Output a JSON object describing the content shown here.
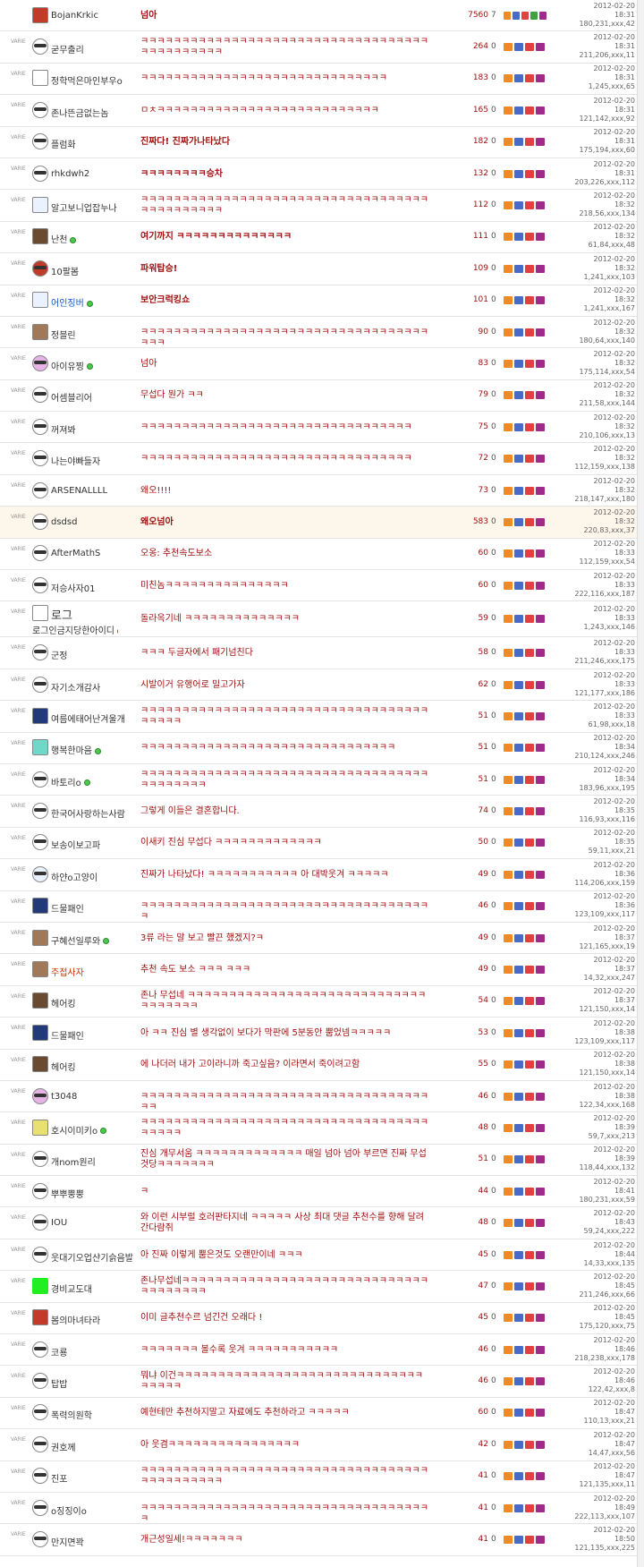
{
  "badge_label": "VARIE",
  "rows": [
    {
      "nick": "BojanKrkic",
      "title": "넘아",
      "views": "7560",
      "rec": "7",
      "date": "2012-02-20",
      "time": "18:31",
      "ip": "180,231,xxx,42",
      "av": "av-red sq",
      "bold": true,
      "top": true
    },
    {
      "nick": "굳무출리",
      "title": "ㅋㅋㅋㅋㅋㅋㅋㅋㅋㅋㅋㅋㅋㅋㅋㅋㅋㅋㅋㅋㅋㅋㅋㅋㅋㅋㅋㅋㅋㅋㅋㅋㅋㅋㅋㅋㅋㅋㅋㅋㅋㅋㅋㅋㅋ",
      "views": "264",
      "rec": "0",
      "date": "2012-02-20",
      "time": "18:31",
      "ip": "211,206,xxx,11",
      "av": ""
    },
    {
      "nick": "정학먹은마인부우o",
      "title": "ㅋㅋㅋㅋㅋㅋㅋㅋㅋㅋㅋㅋㅋㅋㅋㅋㅋㅋㅋㅋㅋㅋㅋㅋㅋㅋㅋㅋㅋㅋ",
      "views": "183",
      "rec": "0",
      "date": "2012-02-20",
      "time": "18:31",
      "ip": "1,245,xxx,65",
      "av": "sq"
    },
    {
      "nick": "존나뜬금없는놈",
      "title": "ㅁㅊㅋㅋㅋㅋㅋㅋㅋㅋㅋㅋㅋㅋㅋㅋㅋㅋㅋㅋㅋㅋㅋㅋㅋㅋㅋㅋㅋ",
      "views": "165",
      "rec": "0",
      "date": "2012-02-20",
      "time": "18:31",
      "ip": "121,142,xxx,92",
      "av": ""
    },
    {
      "nick": "플럼화",
      "title": "진짜다! 진짜가나타났다",
      "views": "182",
      "rec": "0",
      "date": "2012-02-20",
      "time": "18:31",
      "ip": "175,194,xxx,60",
      "av": "",
      "bold": true
    },
    {
      "nick": "rhkdwh2",
      "title": "ㅋㅋㅋㅋㅋㅋㅋㅋ승차",
      "views": "132",
      "rec": "0",
      "date": "2012-02-20",
      "time": "18:31",
      "ip": "203,226,xxx,112",
      "av": "",
      "bold": true
    },
    {
      "nick": "알고보니업잡누나",
      "title": "ㅋㅋㅋㅋㅋㅋㅋㅋㅋㅋㅋㅋㅋㅋㅋㅋㅋㅋㅋㅋㅋㅋㅋㅋㅋㅋㅋㅋㅋㅋㅋㅋㅋㅋㅋㅋㅋㅋㅋㅋㅋㅋㅋㅋㅋ",
      "views": "112",
      "rec": "0",
      "date": "2012-02-20",
      "time": "18:32",
      "ip": "218,56,xxx,134",
      "av": "av-blue sq"
    },
    {
      "nick": "난천",
      "title": "여기까지 ㅋㅋㅋㅋㅋㅋㅋㅋㅋㅋㅋㅋㅋㅋ",
      "views": "111",
      "rec": "0",
      "date": "2012-02-20",
      "time": "18:32",
      "ip": "61,84,xxx,48",
      "av": "av-dark sq",
      "on": true,
      "bold": true
    },
    {
      "nick": "10팔봄",
      "title": "파워탑승!",
      "views": "109",
      "rec": "0",
      "date": "2012-02-20",
      "time": "18:32",
      "ip": "1,241,xxx,103",
      "av": "av-red",
      "bold": true
    },
    {
      "nick": "어인징버",
      "title": "보안크럭킹쇼",
      "views": "101",
      "rec": "0",
      "date": "2012-02-20",
      "time": "18:32",
      "ip": "1,241,xxx,167",
      "av": "av-blue sq",
      "nc": "blue",
      "on": true,
      "bold": true
    },
    {
      "nick": "정블린",
      "title": "ㅋㅋㅋㅋㅋㅋㅋㅋㅋㅋㅋㅋㅋㅋㅋㅋㅋㅋㅋㅋㅋㅋㅋㅋㅋㅋㅋㅋㅋㅋㅋㅋㅋㅋㅋㅋㅋㅋ",
      "views": "90",
      "rec": "0",
      "date": "2012-02-20",
      "time": "18:32",
      "ip": "180,64,xxx,140",
      "av": "av-photo sq"
    },
    {
      "nick": "아이유찡",
      "title": "넘아",
      "views": "83",
      "rec": "0",
      "date": "2012-02-20",
      "time": "18:32",
      "ip": "175,114,xxx,54",
      "av": "av-pink",
      "on": true
    },
    {
      "nick": "어셈블리어",
      "title": "무섭다 뭔가 ㅋㅋ",
      "views": "79",
      "rec": "0",
      "date": "2012-02-20",
      "time": "18:32",
      "ip": "211,58,xxx,144",
      "av": ""
    },
    {
      "nick": "꺼져봐",
      "title": "ㅋㅋㅋㅋㅋㅋㅋㅋㅋㅋㅋㅋㅋㅋㅋㅋㅋㅋㅋㅋㅋㅋㅋㅋㅋㅋㅋㅋㅋㅋㅋㅋㅋ",
      "views": "75",
      "rec": "0",
      "date": "2012-02-20",
      "time": "18:32",
      "ip": "210,106,xxx,13",
      "av": ""
    },
    {
      "nick": "나는야빠들자",
      "title": "ㅋㅋㅋㅋㅋㅋㅋㅋㅋㅋㅋㅋㅋㅋㅋㅋㅋㅋㅋㅋㅋㅋㅋㅋㅋㅋㅋㅋㅋㅋㅋㅋㅋ",
      "views": "72",
      "rec": "0",
      "date": "2012-02-20",
      "time": "18:32",
      "ip": "112,159,xxx,138",
      "av": ""
    },
    {
      "nick": "ARSENALLLL",
      "title": "왜오!!!!",
      "views": "73",
      "rec": "0",
      "date": "2012-02-20",
      "time": "18:32",
      "ip": "218,147,xxx,180",
      "av": ""
    },
    {
      "nick": "dsdsd",
      "title": "왜오넘아",
      "views": "583",
      "rec": "0",
      "date": "2012-02-20",
      "time": "18:32",
      "ip": "220,83,xxx,37",
      "av": "",
      "bold": true,
      "hl": true
    },
    {
      "nick": "AfterMathS",
      "title": "오옹: 추천속도보소",
      "views": "60",
      "rec": "0",
      "date": "2012-02-20",
      "time": "18:33",
      "ip": "112,159,xxx,54",
      "av": ""
    },
    {
      "nick": "저승사자01",
      "title": "미친놈ㅋㅋㅋㅋㅋㅋㅋㅋㅋㅋㅋㅋㅋㅋㅋ",
      "views": "60",
      "rec": "0",
      "date": "2012-02-20",
      "time": "18:33",
      "ip": "222,116,xxx,187",
      "av": ""
    },
    {
      "nick": "로그인금지당한아이디",
      "title": "돌라옥기네 ㅋㅋㅋㅋㅋㅋㅋㅋㅋㅋㅋㅋㅋㅋ",
      "views": "59",
      "rec": "0",
      "date": "2012-02-20",
      "time": "18:33",
      "ip": "1,243,xxx,146",
      "av": "sq",
      "on": true,
      "tall": true,
      "extra": "로그"
    },
    {
      "nick": "군정",
      "title": "ㅋㅋㅋ 두글자에서 패기넘친다",
      "views": "58",
      "rec": "0",
      "date": "2012-02-20",
      "time": "18:33",
      "ip": "211,246,xxx,175",
      "av": ""
    },
    {
      "nick": "자기소개감사",
      "title": "시발이거 유행어로 밀고가자",
      "views": "62",
      "rec": "0",
      "date": "2012-02-20",
      "time": "18:33",
      "ip": "121,177,xxx,186",
      "av": ""
    },
    {
      "nick": "여름에태어난겨울개",
      "title": "ㅋㅋㅋㅋㅋㅋㅋㅋㅋㅋㅋㅋㅋㅋㅋㅋㅋㅋㅋㅋㅋㅋㅋㅋㅋㅋㅋㅋㅋㅋㅋㅋㅋㅋㅋㅋㅋㅋㅋㅋ",
      "views": "51",
      "rec": "0",
      "date": "2012-02-20",
      "time": "18:33",
      "ip": "61,98,xxx,18",
      "av": "av-navy sq"
    },
    {
      "nick": "행복한마음",
      "title": "ㅋㅋㅋㅋㅋㅋㅋㅋㅋㅋㅋㅋㅋㅋㅋㅋㅋㅋㅋㅋㅋㅋㅋㅋㅋㅋㅋㅋㅋㅋㅋ",
      "views": "51",
      "rec": "0",
      "date": "2012-02-20",
      "time": "18:34",
      "ip": "210,124,xxx,246",
      "av": "av-mint sq",
      "on": true
    },
    {
      "nick": "바토리o",
      "title": "ㅋㅋㅋㅋㅋㅋㅋㅋㅋㅋㅋㅋㅋㅋㅋㅋㅋㅋㅋㅋㅋㅋㅋㅋㅋㅋㅋㅋㅋㅋㅋㅋㅋㅋㅋㅋㅋㅋㅋㅋㅋㅋㅋ",
      "views": "51",
      "rec": "0",
      "date": "2012-02-20",
      "time": "18:34",
      "ip": "183,96,xxx,195",
      "av": "",
      "on": true
    },
    {
      "nick": "한국어사랑하는사람",
      "title": "그렇게 이들은 결혼합니다.",
      "views": "74",
      "rec": "0",
      "date": "2012-02-20",
      "time": "18:35",
      "ip": "116,93,xxx,116",
      "av": ""
    },
    {
      "nick": "보송이보고파",
      "title": "이새키 진심 무섭다 ㅋㅋㅋㅋㅋㅋㅋㅋㅋㅋㅋㅋㅋ",
      "views": "50",
      "rec": "0",
      "date": "2012-02-20",
      "time": "18:35",
      "ip": "59,11,xxx,21",
      "av": ""
    },
    {
      "nick": "하얀o고양이",
      "title": "진짜가 나타났다! ㅋㅋㅋㅋㅋㅋㅋㅋㅋㅋㅋ 아 대박웃겨 ㅋㅋㅋㅋㅋ",
      "views": "49",
      "rec": "0",
      "date": "2012-02-20",
      "time": "18:36",
      "ip": "114,206,xxx,159",
      "av": "av-blue"
    },
    {
      "nick": "드물패인",
      "title": "ㅋㅋㅋㅋㅋㅋㅋㅋㅋㅋㅋㅋㅋㅋㅋㅋㅋㅋㅋㅋㅋㅋㅋㅋㅋㅋㅋㅋㅋㅋㅋㅋㅋㅋㅋㅋ",
      "views": "46",
      "rec": "0",
      "date": "2012-02-20",
      "time": "18:36",
      "ip": "123,109,xxx,117",
      "av": "av-navy sq"
    },
    {
      "nick": "구혜선일루와",
      "title": "3류 라는 말 보고 빨끈 했겠지?ㅋ",
      "views": "49",
      "rec": "0",
      "date": "2012-02-20",
      "time": "18:37",
      "ip": "121,165,xxx,19",
      "av": "av-photo sq",
      "on": true
    },
    {
      "nick": "주접사자",
      "title": "추천 속도 보소 ㅋㅋㅋ ㅋㅋㅋ",
      "views": "49",
      "rec": "0",
      "date": "2012-02-20",
      "time": "18:37",
      "ip": "14,32,xxx,247",
      "av": "av-photo sq",
      "nc": "red"
    },
    {
      "nick": "헤어킹",
      "title": "존나 무섭네 ㅋㅋㅋㅋㅋㅋㅋㅋㅋㅋㅋㅋㅋㅋㅋㅋㅋㅋㅋㅋㅋㅋㅋㅋㅋㅋㅋㅋㅋㅋㅋㅋㅋㅋㅋㅋ",
      "views": "54",
      "rec": "0",
      "date": "2012-02-20",
      "time": "18:37",
      "ip": "121,150,xxx,14",
      "av": "av-dark sq"
    },
    {
      "nick": "드물패인",
      "title": "아 ㅋㅋ 진심 별 생각없이 보다가 막판에 5분동안 뿜었넴ㅋㅋㅋㅋㅋ",
      "views": "53",
      "rec": "0",
      "date": "2012-02-20",
      "time": "18:38",
      "ip": "123,109,xxx,117",
      "av": "av-navy sq"
    },
    {
      "nick": "헤어킹",
      "title": "에 나더러 내가 고이라니까 죽고싶음? 이라면서 죽이려고함",
      "views": "55",
      "rec": "0",
      "date": "2012-02-20",
      "time": "18:38",
      "ip": "121,150,xxx,14",
      "av": "av-dark sq"
    },
    {
      "nick": "t3048",
      "title": "ㅋㅋㅋㅋㅋㅋㅋㅋㅋㅋㅋㅋㅋㅋㅋㅋㅋㅋㅋㅋㅋㅋㅋㅋㅋㅋㅋㅋㅋㅋㅋㅋㅋㅋㅋㅋㅋ",
      "views": "46",
      "rec": "0",
      "date": "2012-02-20",
      "time": "18:38",
      "ip": "122,34,xxx,168",
      "av": "av-pink"
    },
    {
      "nick": "호시이미키o",
      "title": "ㅋㅋㅋㅋㅋㅋㅋㅋㅋㅋㅋㅋㅋㅋㅋㅋㅋㅋㅋㅋㅋㅋㅋㅋㅋㅋㅋㅋㅋㅋㅋㅋㅋㅋㅋㅋㅋㅋㅋㅋ",
      "views": "48",
      "rec": "0",
      "date": "2012-02-20",
      "time": "18:39",
      "ip": "59,7,xxx,213",
      "av": "av-yellow sq",
      "on": true
    },
    {
      "nick": "개nom원리",
      "title": "진심 개무서움 ㅋㅋㅋㅋㅋㅋㅋㅋㅋㅋㅋㅋㅋ 매일 넘아 넘아 부르면 진짜 무섭것당ㅋㅋㅋㅋㅋㅋㅋ",
      "views": "51",
      "rec": "0",
      "date": "2012-02-20",
      "time": "18:39",
      "ip": "118,44,xxx,132",
      "av": ""
    },
    {
      "nick": "뿌뿌뿡뿡",
      "title": "ㅋ",
      "views": "44",
      "rec": "0",
      "date": "2012-02-20",
      "time": "18:41",
      "ip": "180,231,xxx,59",
      "av": ""
    },
    {
      "nick": "IOU",
      "title": "와 이런 시부럴 호러판타지네 ㅋㅋㅋㅋㅋ 사상 최대 댓글 추천수를 향해 달려간다람쥐",
      "views": "48",
      "rec": "0",
      "date": "2012-02-20",
      "time": "18:43",
      "ip": "59,24,xxx,222",
      "av": ""
    },
    {
      "nick": "웃대기오업샨기슭음발",
      "title": "아 진짜 이렇게 뿜은것도 오랜만이네 ㅋㅋㅋ",
      "views": "45",
      "rec": "0",
      "date": "2012-02-20",
      "time": "18:44",
      "ip": "14,33,xxx,135",
      "av": ""
    },
    {
      "nick": "경비교도대",
      "title": "존나무섭네ㅋㅋㅋㅋㅋㅋㅋㅋㅋㅋㅋㅋㅋㅋㅋㅋㅋㅋㅋㅋㅋㅋㅋㅋㅋㅋㅋㅋㅋㅋㅋㅋㅋㅋㅋㅋㅋㅋ",
      "views": "47",
      "rec": "0",
      "date": "2012-02-20",
      "time": "18:45",
      "ip": "211,246,xxx,66",
      "av": "av-green sq"
    },
    {
      "nick": "봄의마녀타라",
      "title": "이미 글추천수르 넘긴건 오래다 !",
      "views": "45",
      "rec": "0",
      "date": "2012-02-20",
      "time": "18:45",
      "ip": "175,120,xxx,75",
      "av": "av-red sq"
    },
    {
      "nick": "코룡",
      "title": "ㅋㅋㅋㅋㅋㅋㅋ 볼수록 웃겨 ㅋㅋㅋㅋㅋㅋㅋㅋㅋㅋㅋ",
      "views": "46",
      "rec": "0",
      "date": "2012-02-20",
      "time": "18:46",
      "ip": "218,238,xxx,178",
      "av": ""
    },
    {
      "nick": "탑밥",
      "title": "뭐냐 이건ㅋㅋㅋㅋㅋㅋㅋㅋㅋㅋㅋㅋㅋㅋㅋㅋㅋㅋㅋㅋㅋㅋㅋㅋㅋㅋㅋㅋㅋㅋㅋㅋㅋㅋㅋ",
      "views": "46",
      "rec": "0",
      "date": "2012-02-20",
      "time": "18:46",
      "ip": "122,42,xxx,8",
      "av": ""
    },
    {
      "nick": "폭력의원학",
      "title": "예현테만 추천하지말고 자료에도 추천하라고 ㅋㅋㅋㅋㅋ",
      "views": "60",
      "rec": "0",
      "date": "2012-02-20",
      "time": "18:47",
      "ip": "110,13,xxx,21",
      "av": ""
    },
    {
      "nick": "권호께",
      "title": "아 웃겸ㅋㅋㅋㅋㅋㅋㅋㅋㅋㅋㅋㅋㅋㅋㅋㅋ",
      "views": "42",
      "rec": "0",
      "date": "2012-02-20",
      "time": "18:47",
      "ip": "14,47,xxx,56",
      "av": ""
    },
    {
      "nick": "진포",
      "title": "ㅋㅋㅋㅋㅋㅋㅋㅋㅋㅋㅋㅋㅋㅋㅋㅋㅋㅋㅋㅋㅋㅋㅋㅋㅋㅋㅋㅋㅋㅋㅋㅋㅋㅋㅋㅋㅋㅋㅋㅋㅋㅋㅋㅋㅋ",
      "views": "41",
      "rec": "0",
      "date": "2012-02-20",
      "time": "18:47",
      "ip": "121,135,xxx,11",
      "av": ""
    },
    {
      "nick": "o징징이o",
      "title": "ㅋㅋㅋㅋㅋㅋㅋㅋㅋㅋㅋㅋㅋㅋㅋㅋㅋㅋㅋㅋㅋㅋㅋㅋㅋㅋㅋㅋㅋㅋㅋㅋㅋㅋㅋㅋ",
      "views": "41",
      "rec": "0",
      "date": "2012-02-20",
      "time": "18:49",
      "ip": "222,113,xxx,107",
      "av": ""
    },
    {
      "nick": "만지면꽉",
      "title": "개근성일세!ㅋㅋㅋㅋㅋㅋㅋ",
      "views": "41",
      "rec": "0",
      "date": "2012-02-20",
      "time": "18:50",
      "ip": "121,135,xxx,225",
      "av": ""
    }
  ]
}
